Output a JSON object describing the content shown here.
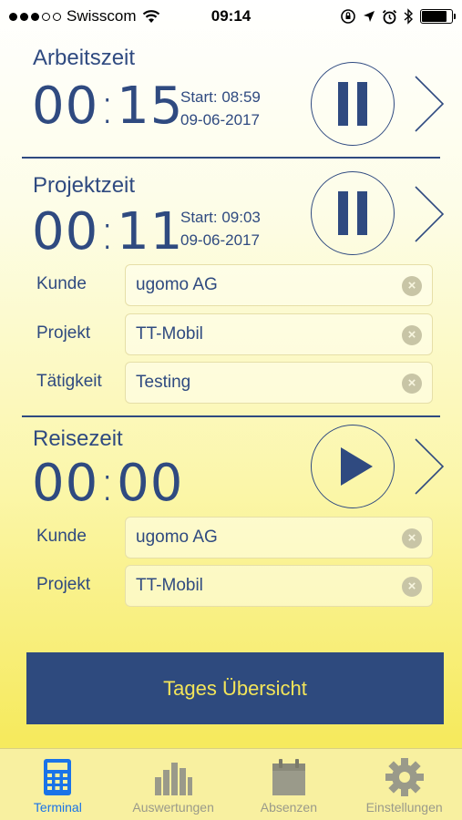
{
  "status_bar": {
    "carrier": "Swisscom",
    "time": "09:14",
    "signal_dots_filled": 3,
    "signal_dots_total": 5,
    "battery_level": 0.85
  },
  "arbeitszeit": {
    "title": "Arbeitszeit",
    "elapsed_hours": "00",
    "elapsed_minutes": "15",
    "start_label": "Start: 08:59",
    "start_date": "09-06-2017",
    "button_icon": "pause-icon"
  },
  "projektzeit": {
    "title": "Projektzeit",
    "elapsed_hours": "00",
    "elapsed_minutes": "11",
    "start_label": "Start: 09:03",
    "start_date": "09-06-2017",
    "button_icon": "pause-icon",
    "fields": [
      {
        "label": "Kunde",
        "value": "ugomo AG"
      },
      {
        "label": "Projekt",
        "value": "TT-Mobil"
      },
      {
        "label": "Tätigkeit",
        "value": "Testing"
      }
    ]
  },
  "reisezeit": {
    "title": "Reisezeit",
    "elapsed_hours": "00",
    "elapsed_minutes": "00",
    "button_icon": "play-icon",
    "fields": [
      {
        "label": "Kunde",
        "value": "ugomo AG"
      },
      {
        "label": "Projekt",
        "value": "TT-Mobil"
      }
    ]
  },
  "overview_button": {
    "label": "Tages Übersicht"
  },
  "tabs": [
    {
      "label": "Terminal",
      "icon": "calculator-icon",
      "active": true
    },
    {
      "label": "Auswertungen",
      "icon": "bar-chart-icon",
      "active": false
    },
    {
      "label": "Absenzen",
      "icon": "calendar-icon",
      "active": false
    },
    {
      "label": "Einstellungen",
      "icon": "gear-icon",
      "active": false
    }
  ],
  "colors": {
    "primary": "#2f4a80",
    "accent_text": "#f3e559",
    "active_tab": "#1a73e8",
    "inactive_tab": "#9a9a8a"
  }
}
